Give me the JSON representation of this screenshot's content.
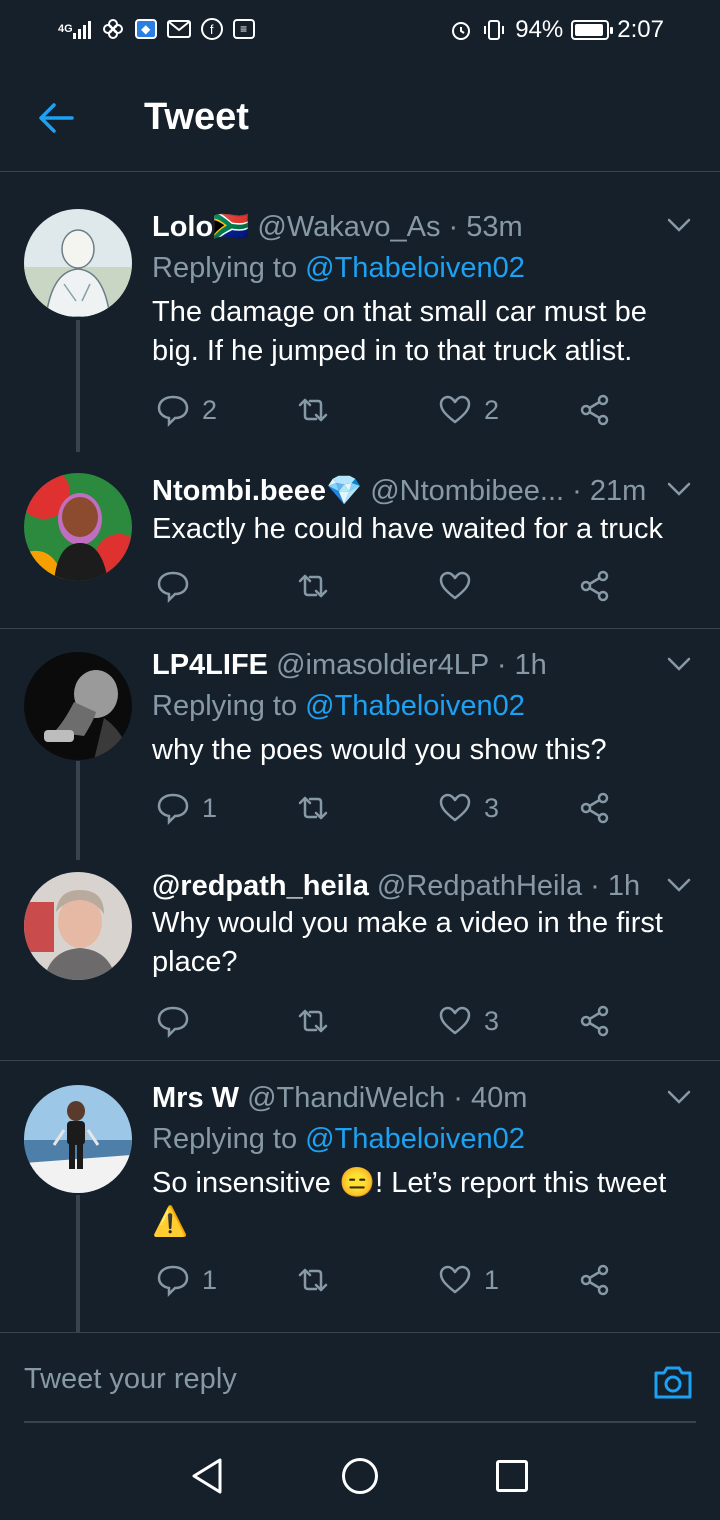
{
  "status_bar": {
    "network": "4G",
    "battery": "94%",
    "time": "2:07"
  },
  "header": {
    "title": "Tweet"
  },
  "tweets": [
    {
      "name": "Lolo🇿🇦",
      "handle": "@Wakavo_As",
      "time": "· 53m",
      "replying_prefix": "Replying to",
      "replying_to": "@Thabeloiven02",
      "text": "The damage on that small car must be big. If he jumped in to that truck atlist.",
      "replies": "2",
      "retweets": "",
      "likes": "2"
    },
    {
      "name": "Ntombi.beee💎",
      "handle": "@Ntombibee...",
      "time": "· 21m",
      "text": "Exactly he could have waited for a truck",
      "replies": "",
      "retweets": "",
      "likes": ""
    },
    {
      "name": "LP4LIFE",
      "handle": "@imasoldier4LP",
      "time": "· 1h",
      "replying_prefix": "Replying to",
      "replying_to": "@Thabeloiven02",
      "text": "why the poes would you show this?",
      "replies": "1",
      "retweets": "",
      "likes": "3"
    },
    {
      "name": "@redpath_heila",
      "handle": "@RedpathHeila",
      "time": "· 1h",
      "text": "Why would you make a video in the first place?",
      "replies": "",
      "retweets": "",
      "likes": "3"
    },
    {
      "name": "Mrs W",
      "handle": "@ThandiWelch",
      "time": "· 40m",
      "replying_prefix": "Replying to",
      "replying_to": "@Thabeloiven02",
      "text": "So insensitive 😑! Let’s report this tweet ⚠️",
      "replies": "1",
      "retweets": "",
      "likes": "1"
    }
  ],
  "reply_bar": {
    "placeholder": "Tweet your reply"
  },
  "colors": {
    "background": "#15202b",
    "accent": "#1da1f2",
    "muted": "#8899a6",
    "divider": "#38444d"
  }
}
